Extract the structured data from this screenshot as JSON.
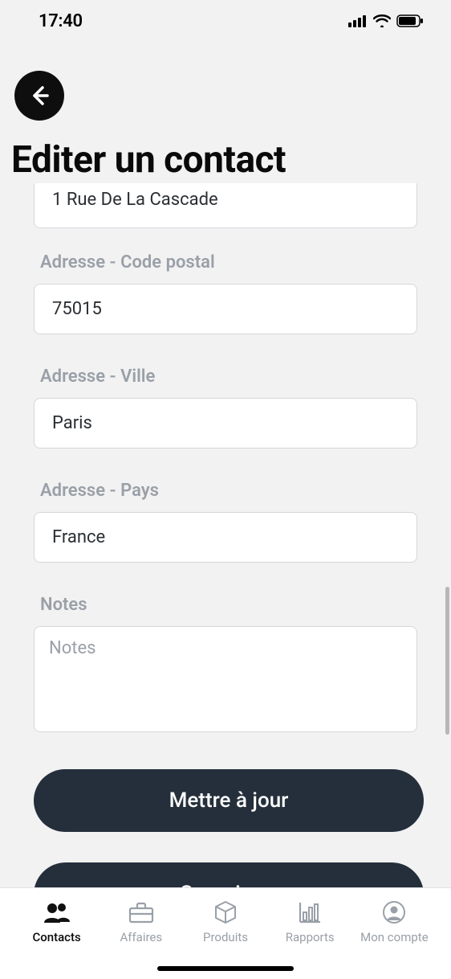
{
  "status": {
    "time": "17:40"
  },
  "page": {
    "title": "Editer un contact"
  },
  "form": {
    "street": {
      "value": "1 Rue De La Cascade"
    },
    "postal": {
      "label": "Adresse - Code postal",
      "value": "75015"
    },
    "city": {
      "label": "Adresse - Ville",
      "value": "Paris"
    },
    "country": {
      "label": "Adresse - Pays",
      "value": "France"
    },
    "notes": {
      "label": "Notes",
      "placeholder": "Notes"
    }
  },
  "buttons": {
    "update": "Mettre à jour",
    "delete": "Supprimer"
  },
  "nav": {
    "contacts": "Contacts",
    "affaires": "Affaires",
    "produits": "Produits",
    "rapports": "Rapports",
    "compte": "Mon compte"
  }
}
